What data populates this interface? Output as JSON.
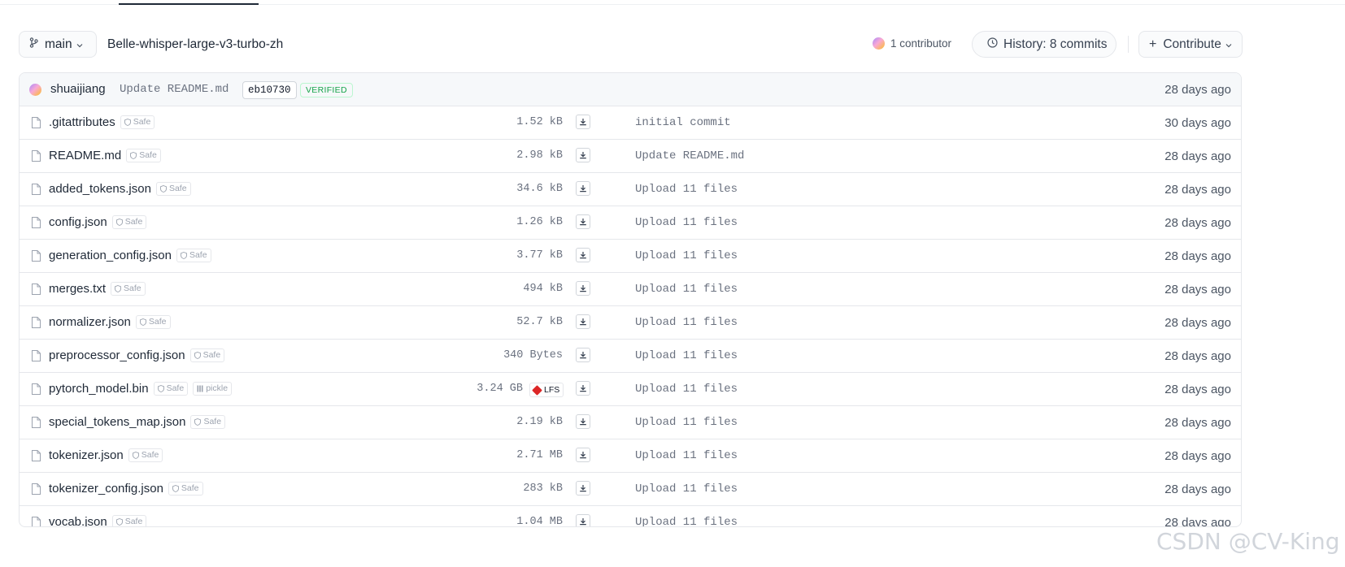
{
  "toolbar": {
    "branch": "main",
    "repo_name": "Belle-whisper-large-v3-turbo-zh",
    "contributors": "1 contributor",
    "history": "History: 8 commits",
    "contribute": "Contribute"
  },
  "latest_commit": {
    "author": "shuaijiang",
    "message": "Update README.md",
    "hash": "eb10730",
    "verified": "VERIFIED",
    "date": "28 days ago"
  },
  "files": [
    {
      "name": ".gitattributes",
      "badges": [
        "Safe"
      ],
      "size": "1.52 kB",
      "commit": "initial commit",
      "date": "30 days ago"
    },
    {
      "name": "README.md",
      "badges": [
        "Safe"
      ],
      "size": "2.98 kB",
      "commit": "Update README.md",
      "date": "28 days ago"
    },
    {
      "name": "added_tokens.json",
      "badges": [
        "Safe"
      ],
      "size": "34.6 kB",
      "commit": "Upload 11 files",
      "date": "28 days ago"
    },
    {
      "name": "config.json",
      "badges": [
        "Safe"
      ],
      "size": "1.26 kB",
      "commit": "Upload 11 files",
      "date": "28 days ago"
    },
    {
      "name": "generation_config.json",
      "badges": [
        "Safe"
      ],
      "size": "3.77 kB",
      "commit": "Upload 11 files",
      "date": "28 days ago"
    },
    {
      "name": "merges.txt",
      "badges": [
        "Safe"
      ],
      "size": "494 kB",
      "commit": "Upload 11 files",
      "date": "28 days ago"
    },
    {
      "name": "normalizer.json",
      "badges": [
        "Safe"
      ],
      "size": "52.7 kB",
      "commit": "Upload 11 files",
      "date": "28 days ago"
    },
    {
      "name": "preprocessor_config.json",
      "badges": [
        "Safe"
      ],
      "size": "340 Bytes",
      "commit": "Upload 11 files",
      "date": "28 days ago"
    },
    {
      "name": "pytorch_model.bin",
      "badges": [
        "Safe",
        "pickle"
      ],
      "size": "3.24 GB",
      "lfs": "LFS",
      "commit": "Upload 11 files",
      "date": "28 days ago"
    },
    {
      "name": "special_tokens_map.json",
      "badges": [
        "Safe"
      ],
      "size": "2.19 kB",
      "commit": "Upload 11 files",
      "date": "28 days ago"
    },
    {
      "name": "tokenizer.json",
      "badges": [
        "Safe"
      ],
      "size": "2.71 MB",
      "commit": "Upload 11 files",
      "date": "28 days ago"
    },
    {
      "name": "tokenizer_config.json",
      "badges": [
        "Safe"
      ],
      "size": "283 kB",
      "commit": "Upload 11 files",
      "date": "28 days ago"
    },
    {
      "name": "vocab.json",
      "badges": [
        "Safe"
      ],
      "size": "1.04 MB",
      "commit": "Upload 11 files",
      "date": "28 days ago"
    }
  ],
  "watermark": "CSDN @CV-King"
}
